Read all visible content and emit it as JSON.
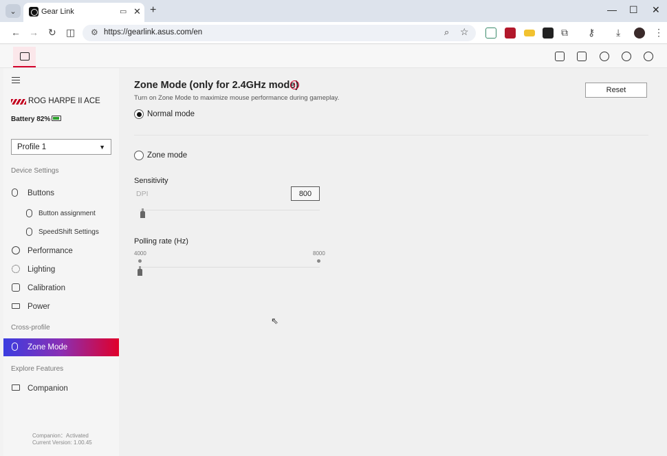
{
  "browser": {
    "tab_title": "Gear Link",
    "url": "https://gearlink.asus.com/en",
    "new_tab": "+",
    "controls": {
      "minimize": "—",
      "maximize": "☐",
      "close": "✕"
    }
  },
  "sidebar": {
    "device_name": "ROG HARPE II ACE",
    "battery": "Battery 82%",
    "profile": "Profile 1",
    "device_settings_label": "Device Settings",
    "items": {
      "buttons": "Buttons",
      "button_assignment": "Button assignment",
      "speedshift": "SpeedShift Settings",
      "performance": "Performance",
      "lighting": "Lighting",
      "calibration": "Calibration",
      "power": "Power"
    },
    "cross_profile_label": "Cross-profile",
    "zone_mode": "Zone Mode",
    "explore_label": "Explore Features",
    "companion": "Companion",
    "footer": {
      "companion_status": "Companion：Activated",
      "version": "Current Version: 1.00.45"
    }
  },
  "main": {
    "title": "Zone Mode (only for 2.4GHz mode)",
    "info_glyph": "i",
    "description": "Turn on Zone Mode to maximize mouse performance during gameplay.",
    "reset_label": "Reset",
    "normal_mode": "Normal mode",
    "zone_mode": "Zone mode",
    "sensitivity_label": "Sensitivity",
    "dpi_label": "DPI",
    "dpi_value": "800",
    "polling_label": "Polling rate (Hz)",
    "polling_min": "4000",
    "polling_max": "8000"
  },
  "state": {
    "selected_mode": "normal",
    "dpi_slider_fraction": 0.0,
    "polling_slider_fraction": 0.0
  },
  "colors": {
    "accent_red": "#d4002a",
    "active_gradient_start": "#3b3de0",
    "active_gradient_end": "#e0002a"
  }
}
